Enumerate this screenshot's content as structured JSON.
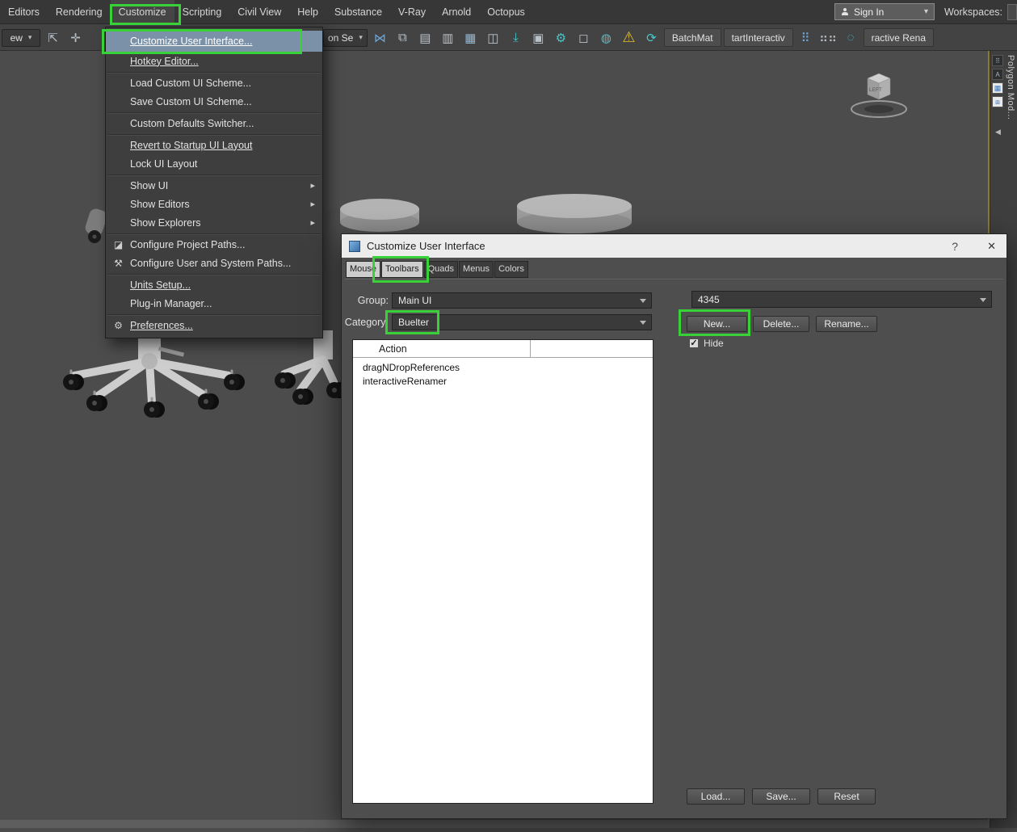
{
  "colors": {
    "annotation_green": "#38d238",
    "menu_selection": "#7b91a8",
    "warning_yellow": "#e2bc35",
    "teal_accent": "#45c8cc",
    "blue_accent": "#6aa7dc"
  },
  "menubar": {
    "items": [
      {
        "label": "Editors",
        "name": "menu-editors"
      },
      {
        "label": "Rendering",
        "name": "menu-rendering"
      },
      {
        "label": "Customize",
        "name": "menu-customize",
        "active": true
      },
      {
        "label": "Scripting",
        "name": "menu-scripting"
      },
      {
        "label": "Civil View",
        "name": "menu-civil-view"
      },
      {
        "label": "Help",
        "name": "menu-help"
      },
      {
        "label": "Substance",
        "name": "menu-substance"
      },
      {
        "label": "V-Ray",
        "name": "menu-vray"
      },
      {
        "label": "Arnold",
        "name": "menu-arnold"
      },
      {
        "label": "Octopus",
        "name": "menu-octopus"
      }
    ],
    "sign_in": {
      "label": "Sign In",
      "arrow": "▾"
    },
    "workspaces_label": "Workspaces:"
  },
  "toolbar": {
    "left_items": [
      {
        "label": "ew",
        "arrow": "▾",
        "name": "viewport-layout-dropdown",
        "dropdown": true
      },
      {
        "glyph": "⇱",
        "name": "select-and-link-icon"
      },
      {
        "glyph": "✛",
        "name": "select-and-move-icon"
      }
    ],
    "right_items": [
      {
        "label": "on Se",
        "arrow": "▾",
        "name": "selection-set-dropdown",
        "dropdown": true
      },
      {
        "glyph": "⋈",
        "name": "mirror-icon",
        "blue": true
      },
      {
        "glyph": "⧉",
        "name": "align-icon"
      },
      {
        "glyph": "▤",
        "name": "toggle-scene-explorer-icon"
      },
      {
        "glyph": "▥",
        "name": "toggle-layer-explorer-icon"
      },
      {
        "glyph": "▦",
        "name": "ribbon-toggle-icon",
        "accent": true
      },
      {
        "glyph": "◫",
        "name": "curve-editor-icon"
      },
      {
        "glyph": "⤓",
        "name": "schematic-view-icon",
        "teal": true
      },
      {
        "glyph": "▣",
        "name": "material-editor-icon"
      },
      {
        "glyph": "⚙",
        "name": "render-setup-icon",
        "teal": true
      },
      {
        "glyph": "◻",
        "name": "rendered-frame-window-icon"
      },
      {
        "glyph": "◍",
        "name": "render-production-icon",
        "teal": true
      },
      {
        "glyph": "⚠",
        "name": "warning-icon",
        "warning": true
      },
      {
        "glyph": "⟳",
        "name": "refresh-icon",
        "teal": true
      },
      {
        "label": "BatchMat",
        "name": "batchmat-button",
        "button": true
      },
      {
        "label": "tartInteractiv",
        "name": "start-interactive-button",
        "button": true
      },
      {
        "glyph": "⠿",
        "name": "dots-grid-icon",
        "blue": true
      },
      {
        "glyph": "⠶⠶",
        "name": "measure-icon"
      },
      {
        "glyph": "◌",
        "name": "dots-circle-icon",
        "teal": true
      },
      {
        "label": "ractive Rena",
        "name": "interactive-rename-button",
        "button": true
      }
    ]
  },
  "customize_menu": {
    "items": [
      {
        "label": "Customize User Interface...",
        "name": "menu-item-customize-user-interface",
        "selected": true,
        "underline": true
      },
      {
        "label": "Hotkey Editor...",
        "name": "menu-item-hotkey-editor",
        "underline": true,
        "separator_after": true
      },
      {
        "label": "Load Custom UI Scheme...",
        "name": "menu-item-load-custom-ui-scheme"
      },
      {
        "label": "Save Custom UI Scheme...",
        "name": "menu-item-save-custom-ui-scheme",
        "separator_after": true
      },
      {
        "label": "Custom Defaults Switcher...",
        "name": "menu-item-custom-defaults-switcher",
        "separator_after": true
      },
      {
        "label": "Revert to Startup UI Layout",
        "name": "menu-item-revert-startup-ui-layout",
        "underline": true
      },
      {
        "label": "Lock UI Layout",
        "name": "menu-item-lock-ui-layout",
        "separator_after": true
      },
      {
        "label": "Show UI",
        "name": "menu-item-show-ui",
        "submenu": true
      },
      {
        "label": "Show Editors",
        "name": "menu-item-show-editors",
        "submenu": true
      },
      {
        "label": "Show Explorers",
        "name": "menu-item-show-explorers",
        "submenu": true,
        "separator_after": true
      },
      {
        "label": "Configure Project Paths...",
        "name": "menu-item-configure-project-paths",
        "icon_glyph": "◪"
      },
      {
        "label": "Configure User and System Paths...",
        "name": "menu-item-configure-user-system-paths",
        "icon_glyph": "⚒",
        "separator_after": true
      },
      {
        "label": "Units Setup...",
        "name": "menu-item-units-setup",
        "underline": true
      },
      {
        "label": "Plug-in Manager...",
        "name": "menu-item-plugin-manager",
        "separator_after": true
      },
      {
        "label": "Preferences...",
        "name": "menu-item-preferences",
        "underline": true,
        "icon_glyph": "⚙"
      }
    ]
  },
  "dialog": {
    "title": "Customize User Interface",
    "controls": {
      "help": "?",
      "close": "✕"
    },
    "tabs": [
      {
        "label": "Mouse",
        "name": "tab-mouse",
        "light": true
      },
      {
        "label": "Toolbars",
        "name": "tab-toolbars",
        "light": true,
        "active": true
      },
      {
        "label": "Quads",
        "name": "tab-quads"
      },
      {
        "label": "Menus",
        "name": "tab-menus"
      },
      {
        "label": "Colors",
        "name": "tab-colors"
      }
    ],
    "group": {
      "label": "Group:",
      "value": "Main UI"
    },
    "category": {
      "label": "Category:",
      "value": "Buelter"
    },
    "toolbar_name": "4345",
    "buttons": {
      "new": "New...",
      "delete": "Delete...",
      "rename": "Rename...",
      "load": "Load...",
      "save": "Save...",
      "reset": "Reset"
    },
    "hide_checkbox": {
      "label": "Hide",
      "checked": true
    },
    "list": {
      "header": "Action",
      "rows": [
        "dragNDropReferences",
        "interactiveRenamer"
      ]
    }
  },
  "viewport": {
    "viewcube_label": "LEFT",
    "side_panel": {
      "title": "Polygon Mod...",
      "collapse_arrow": "◀",
      "icons": [
        {
          "glyph": "⠿",
          "name": "panel-icon-dots"
        },
        {
          "glyph": "A",
          "name": "panel-icon-a"
        },
        {
          "glyph": "▦",
          "name": "panel-icon-checker",
          "white": true
        },
        {
          "glyph": "⧈",
          "name": "panel-icon-box",
          "white": true
        }
      ]
    }
  }
}
